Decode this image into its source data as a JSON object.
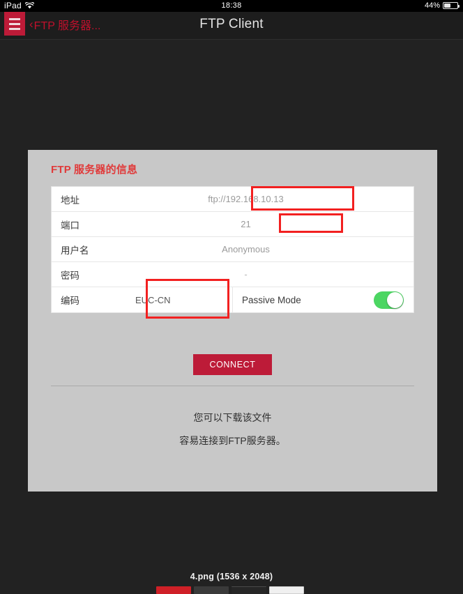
{
  "statusbar": {
    "device": "iPad",
    "wifi_icon": "wifi-icon",
    "time": "18:38",
    "battery_percent": "44%",
    "battery_icon": "battery-icon"
  },
  "navbar": {
    "menu_icon": "hamburger-menu-icon",
    "back_chevron": "‹",
    "back_label": "FTP 服务器...",
    "title": "FTP Client",
    "accent_color": "#bd1b38",
    "back_color": "#c0102c"
  },
  "panel": {
    "title": "FTP 服务器的信息",
    "title_color": "#e03b3b",
    "background": "#c8c8c8"
  },
  "form": {
    "rows": [
      {
        "label": "地址",
        "value": "ftp://192.168.10.13"
      },
      {
        "label": "端口",
        "value": "21"
      },
      {
        "label": "用户名",
        "value": "Anonymous"
      },
      {
        "label": "密码",
        "value": "-"
      }
    ],
    "encoding": {
      "label": "编码",
      "value": "EUC-CN"
    },
    "passive_mode": {
      "label": "Passive Mode",
      "enabled": "on",
      "on_color": "#4cd662"
    }
  },
  "actions": {
    "connect_label": "CONNECT",
    "connect_color": "#bd1b38"
  },
  "notes": {
    "line1": "您可以下载该文件",
    "line2": "容易连接到FTP服务器。"
  },
  "annotations": {
    "color": "#f22020",
    "boxes": [
      {
        "name": "address-highlight",
        "target": "ftp://192.168.10.13"
      },
      {
        "name": "port-highlight",
        "target": "21"
      },
      {
        "name": "encoding-highlight",
        "target": "EUC-CN"
      }
    ]
  },
  "footer": {
    "caption": "4.png (1536 x 2048)"
  }
}
